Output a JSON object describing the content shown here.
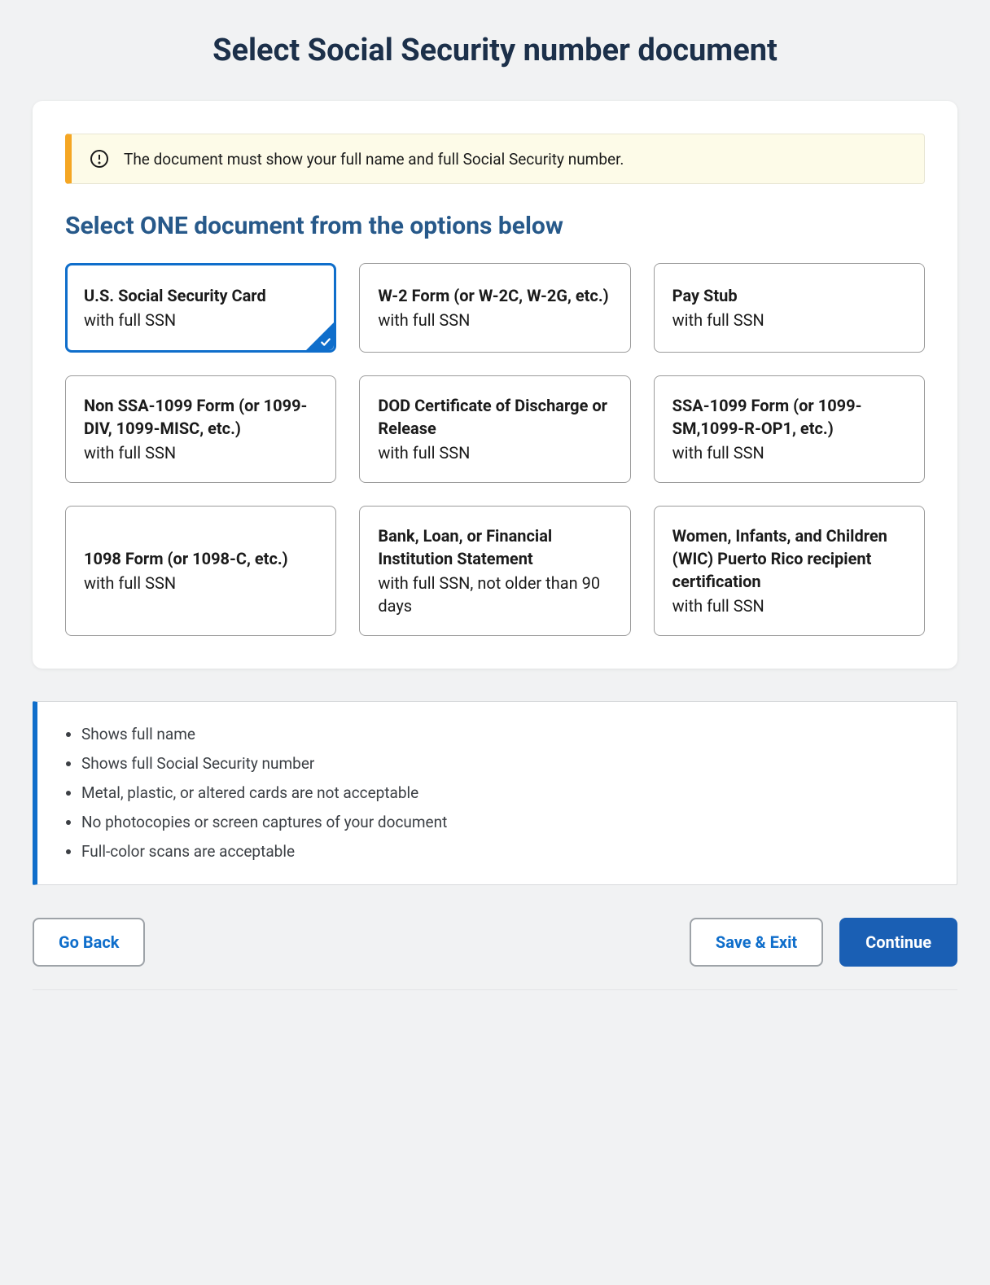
{
  "page_title": "Select Social Security number document",
  "alert_text": "The document must show your full name and full Social Security number.",
  "section_heading": "Select ONE document from the options below",
  "options": [
    {
      "title": "U.S. Social Security Card",
      "sub": "with full SSN",
      "selected": true
    },
    {
      "title": "W-2 Form (or W-2C, W-2G, etc.)",
      "sub": "with full SSN",
      "selected": false
    },
    {
      "title": "Pay Stub",
      "sub": "with full SSN",
      "selected": false
    },
    {
      "title": "Non SSA-1099 Form (or 1099-DIV, 1099-MISC, etc.)",
      "sub": "with full SSN",
      "selected": false
    },
    {
      "title": "DOD Certificate of Discharge or Release",
      "sub": "with full SSN",
      "selected": false
    },
    {
      "title": "SSA-1099 Form (or 1099-SM,1099-R-OP1, etc.)",
      "sub": "with full SSN",
      "selected": false
    },
    {
      "title": "1098 Form (or 1098-C, etc.)",
      "sub": "with full SSN",
      "selected": false
    },
    {
      "title": "Bank, Loan, or Financial Institution Statement",
      "sub": "with full SSN, not older than 90 days",
      "selected": false
    },
    {
      "title": "Women, Infants, and Children (WIC) Puerto Rico recipient certification",
      "sub": "with full SSN",
      "selected": false
    }
  ],
  "requirements": [
    "Shows full name",
    "Shows full Social Security number",
    "Metal, plastic, or altered cards are not acceptable",
    "No photocopies or screen captures of your document",
    "Full-color scans are acceptable"
  ],
  "buttons": {
    "go_back": "Go Back",
    "save_exit": "Save & Exit",
    "continue": "Continue"
  },
  "colors": {
    "primary_blue": "#0f6ecb",
    "button_blue": "#1a5fb4",
    "heading_navy": "#1c304a",
    "section_blue": "#27598a",
    "alert_bg": "#fdfbe8",
    "alert_border": "#f5a623"
  }
}
